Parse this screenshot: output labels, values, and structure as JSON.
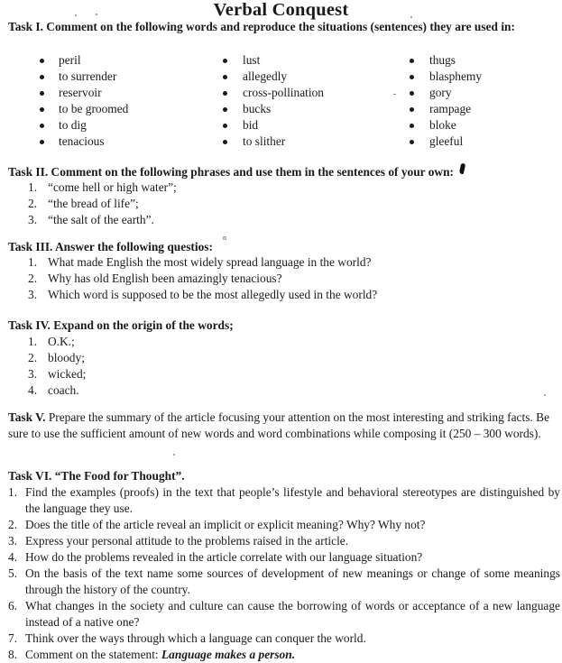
{
  "document": {
    "title": "Verbal Conquest"
  },
  "task1": {
    "heading": "Task I. Comment on the following words and reproduce the situations (sentences) they are used in:",
    "columns": [
      [
        "peril",
        "to surrender",
        "reservoir",
        "to be groomed",
        "to dig",
        "tenacious"
      ],
      [
        "lust",
        "allegedly",
        "cross-pollination",
        "bucks",
        "bid",
        "to slither"
      ],
      [
        "thugs",
        "blasphemy",
        "gory",
        "rampage",
        "bloke",
        "gleeful"
      ]
    ]
  },
  "task2": {
    "heading": "Task II. Comment on the following phrases and use them in the sentences of your own:",
    "items": [
      {
        "num": "1.",
        "text": "“come hell or high water”;"
      },
      {
        "num": "2.",
        "text": "“the bread of life”;"
      },
      {
        "num": "3.",
        "text": "“the salt of the earth”."
      }
    ]
  },
  "task3": {
    "heading": "Task III. Answer the following questios:",
    "items": [
      {
        "num": "1.",
        "text": "What made English the most widely spread language in the world?"
      },
      {
        "num": "2.",
        "text": "Why has old English been amazingly tenacious?"
      },
      {
        "num": "3.",
        "text": "Which word is supposed to be the most allegedly used in the world?"
      }
    ]
  },
  "task4": {
    "heading": "Task IV. Expand on the origin of the words;",
    "items": [
      {
        "num": "1.",
        "text": "O.K.;"
      },
      {
        "num": "2.",
        "text": "bloody;"
      },
      {
        "num": "3.",
        "text": "wicked;"
      },
      {
        "num": "4.",
        "text": "coach."
      }
    ]
  },
  "task5": {
    "label": "Task V.",
    "text": "Prepare the summary of the article focusing your attention on the most interesting and striking facts. Be sure to use the sufficient amount of new words and word combinations while composing it (250 – 300 words)."
  },
  "task6": {
    "heading": "Task VI. “The Food for Thought”.",
    "items": [
      {
        "num": "1.",
        "text": "Find the examples (proofs) in the text that people’s lifestyle and behavioral stereotypes are distinguished by the language they use."
      },
      {
        "num": "2.",
        "text": "Does the title of the article reveal an implicit or explicit meaning? Why? Why not?"
      },
      {
        "num": "3.",
        "text": "Express your personal attitude to the problems raised in the article."
      },
      {
        "num": "4.",
        "text": "How do the problems revealed in the article correlate with our language situation?"
      },
      {
        "num": "5.",
        "text": "On the basis of the text name some sources of development of new meanings or change of some meanings through the history of the country."
      },
      {
        "num": "6.",
        "text": "What changes in the society and culture can cause the borrowing of words or acceptance of a new language instead of a native one?"
      },
      {
        "num": "7.",
        "text": "Think over the ways through which a language can conquer the world."
      },
      {
        "num": "8.",
        "text": "Comment on the statement: ",
        "emphasis": "Language makes a person."
      }
    ]
  },
  "annotations": {
    "handwritten_mark": "n"
  }
}
